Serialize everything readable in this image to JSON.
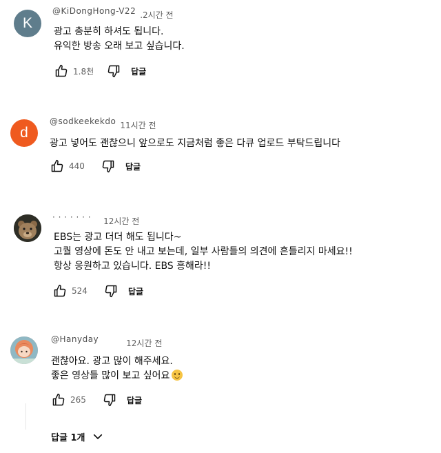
{
  "comments": [
    {
      "avatar_letter": "K",
      "avatar_color": "#5f7d8c",
      "handle": "@KiDongHong-V22",
      "time": ".2시간 전",
      "lines": [
        "광고 충분히 하셔도 됩니다.",
        "유익한 방송 오래 보고 싶습니다."
      ],
      "likes": "1.8천",
      "reply_label": "답글"
    },
    {
      "avatar_letter": "d",
      "avatar_color": "#ef5a1f",
      "handle": "@sodkeekekdo",
      "time": "11시간 전",
      "lines": [
        "광고 넣어도 괜찮으니 앞으로도 지금처럼 좋은 다큐 업로드 부탁드립니다"
      ],
      "likes": "440",
      "reply_label": "답글"
    },
    {
      "avatar_letter": "",
      "avatar_color": "#3a3a2e",
      "handle": "· · · · · · ·",
      "time": "12시간 전",
      "lines": [
        "EBS는 광고 더더 해도 됩니다~",
        "고퀄 영상에 돈도 안 내고 보는데, 일부 사람들의 의견에 흔들리지 마세요!!",
        "항상 응원하고 있습니다. EBS 흥해라!!"
      ],
      "likes": "524",
      "reply_label": "답글"
    },
    {
      "avatar_letter": "",
      "avatar_color": "#e9a48a",
      "handle": "@Hanyday",
      "time": "12시간 전",
      "lines": [
        "괜찮아요. 광고 많이 해주세요.",
        "좋은 영상들 많이 보고 싶어요"
      ],
      "likes": "265",
      "reply_label": "답글"
    }
  ],
  "replies_toggle": "답글 1개",
  "icons": {
    "like": "thumb-up-icon",
    "dislike": "thumb-down-icon",
    "expand": "chevron-down-icon",
    "emoji": "smiling-face-emoji"
  }
}
